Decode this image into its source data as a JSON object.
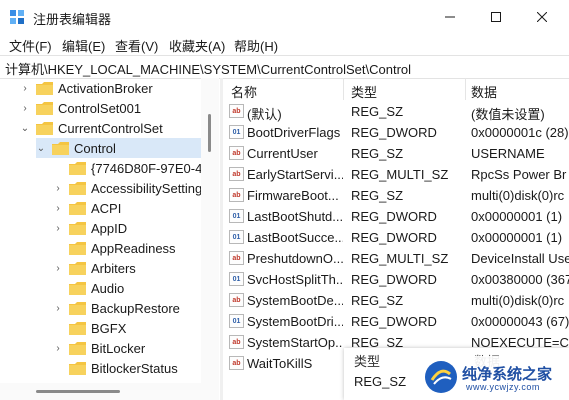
{
  "window": {
    "title": "注册表编辑器"
  },
  "menu": [
    {
      "label": "文件(F)"
    },
    {
      "label": "编辑(E)"
    },
    {
      "label": "查看(V)"
    },
    {
      "label": "收藏夹(A)"
    },
    {
      "label": "帮助(H)"
    }
  ],
  "address": "计算机\\HKEY_LOCAL_MACHINE\\SYSTEM\\CurrentControlSet\\Control",
  "tree": [
    {
      "label": "ActivationBroker",
      "chevron": "›"
    },
    {
      "label": "ControlSet001",
      "chevron": "›"
    },
    {
      "label": "CurrentControlSet",
      "chevron": "⌄"
    },
    {
      "label": "Control",
      "chevron": "⌄"
    },
    {
      "label": "{7746D80F-97E0-4E",
      "chevron": ""
    },
    {
      "label": "AccessibilitySetting",
      "chevron": "›"
    },
    {
      "label": "ACPI",
      "chevron": "›"
    },
    {
      "label": "AppID",
      "chevron": "›"
    },
    {
      "label": "AppReadiness",
      "chevron": ""
    },
    {
      "label": "Arbiters",
      "chevron": "›"
    },
    {
      "label": "Audio",
      "chevron": ""
    },
    {
      "label": "BackupRestore",
      "chevron": "›"
    },
    {
      "label": "BGFX",
      "chevron": ""
    },
    {
      "label": "BitLocker",
      "chevron": "›"
    },
    {
      "label": "BitlockerStatus",
      "chevron": ""
    }
  ],
  "columns": {
    "name": "名称",
    "type": "类型",
    "data": "数据"
  },
  "values": [
    {
      "icon": "ab",
      "name": "(默认)",
      "type": "REG_SZ",
      "data": "(数值未设置)"
    },
    {
      "icon": "bin",
      "name": "BootDriverFlags",
      "type": "REG_DWORD",
      "data": "0x0000001c (28)"
    },
    {
      "icon": "ab",
      "name": "CurrentUser",
      "type": "REG_SZ",
      "data": "USERNAME"
    },
    {
      "icon": "ab",
      "name": "EarlyStartServi...",
      "type": "REG_MULTI_SZ",
      "data": "RpcSs Power Br"
    },
    {
      "icon": "ab",
      "name": "FirmwareBoot...",
      "type": "REG_SZ",
      "data": "multi(0)disk(0)rc"
    },
    {
      "icon": "bin",
      "name": "LastBootShutd...",
      "type": "REG_DWORD",
      "data": "0x00000001 (1)"
    },
    {
      "icon": "bin",
      "name": "LastBootSucce...",
      "type": "REG_DWORD",
      "data": "0x00000001 (1)"
    },
    {
      "icon": "ab",
      "name": "PreshutdownO...",
      "type": "REG_MULTI_SZ",
      "data": "DeviceInstall Use"
    },
    {
      "icon": "bin",
      "name": "SvcHostSplitTh...",
      "type": "REG_DWORD",
      "data": "0x00380000 (367"
    },
    {
      "icon": "ab",
      "name": "SystemBootDe...",
      "type": "REG_SZ",
      "data": "multi(0)disk(0)rc"
    },
    {
      "icon": "bin",
      "name": "SystemBootDri...",
      "type": "REG_DWORD",
      "data": "0x00000043 (67)"
    },
    {
      "icon": "ab",
      "name": "SystemStartOp...",
      "type": "REG_SZ",
      "data": " NOEXECUTE=C"
    },
    {
      "icon": "ab",
      "name": "WaitToKillS",
      "type": "",
      "data": ""
    }
  ],
  "popup": {
    "header_type": "类型",
    "header_data": "数据",
    "value_type": "REG_SZ"
  },
  "watermark": {
    "text": "纯净系统之家",
    "url": "www.ycwjzy.com"
  }
}
